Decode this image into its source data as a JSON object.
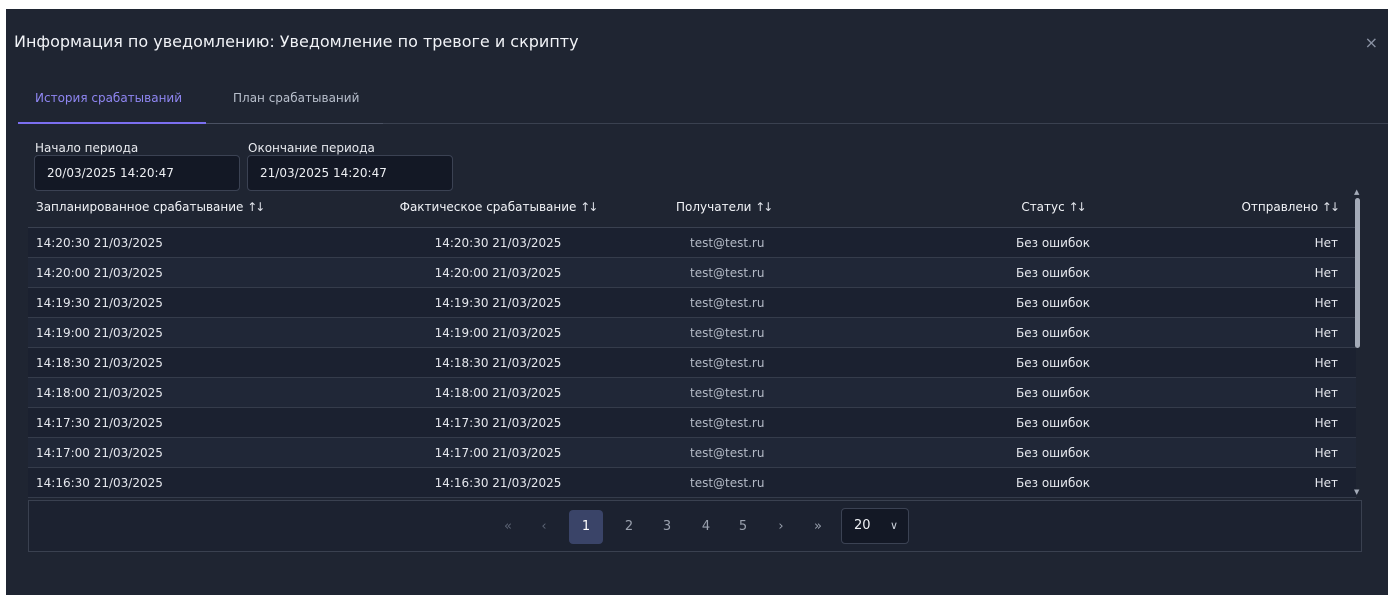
{
  "dialog": {
    "title": "Информация по уведомлению: Уведомление по тревоге и скрипту",
    "close": "×"
  },
  "tabs": [
    {
      "label": "История срабатываний",
      "active": true
    },
    {
      "label": "План срабатываний",
      "active": false
    }
  ],
  "filters": {
    "start_label": "Начало периода",
    "start_value": "20/03/2025 14:20:47",
    "end_label": "Окончание периода",
    "end_value": "21/03/2025 14:20:47"
  },
  "table": {
    "sort_icon": "↑↓",
    "headers": [
      "Запланированное срабатывание",
      "Фактическое срабатывание",
      "Получатели",
      "Статус",
      "Отправлено"
    ],
    "rows": [
      [
        "14:20:30 21/03/2025",
        "14:20:30 21/03/2025",
        "test@test.ru",
        "Без ошибок",
        "Нет"
      ],
      [
        "14:20:00 21/03/2025",
        "14:20:00 21/03/2025",
        "test@test.ru",
        "Без ошибок",
        "Нет"
      ],
      [
        "14:19:30 21/03/2025",
        "14:19:30 21/03/2025",
        "test@test.ru",
        "Без ошибок",
        "Нет"
      ],
      [
        "14:19:00 21/03/2025",
        "14:19:00 21/03/2025",
        "test@test.ru",
        "Без ошибок",
        "Нет"
      ],
      [
        "14:18:30 21/03/2025",
        "14:18:30 21/03/2025",
        "test@test.ru",
        "Без ошибок",
        "Нет"
      ],
      [
        "14:18:00 21/03/2025",
        "14:18:00 21/03/2025",
        "test@test.ru",
        "Без ошибок",
        "Нет"
      ],
      [
        "14:17:30 21/03/2025",
        "14:17:30 21/03/2025",
        "test@test.ru",
        "Без ошибок",
        "Нет"
      ],
      [
        "14:17:00 21/03/2025",
        "14:17:00 21/03/2025",
        "test@test.ru",
        "Без ошибок",
        "Нет"
      ],
      [
        "14:16:30 21/03/2025",
        "14:16:30 21/03/2025",
        "test@test.ru",
        "Без ошибок",
        "Нет"
      ]
    ]
  },
  "pagination": {
    "first": "«",
    "prev": "‹",
    "pages": [
      "1",
      "2",
      "3",
      "4",
      "5"
    ],
    "current": "1",
    "next": "›",
    "last": "»",
    "page_size": "20"
  },
  "colors": {
    "background": "#1f2532",
    "accent": "#7b6ff0",
    "current_page": "#3a4468"
  }
}
